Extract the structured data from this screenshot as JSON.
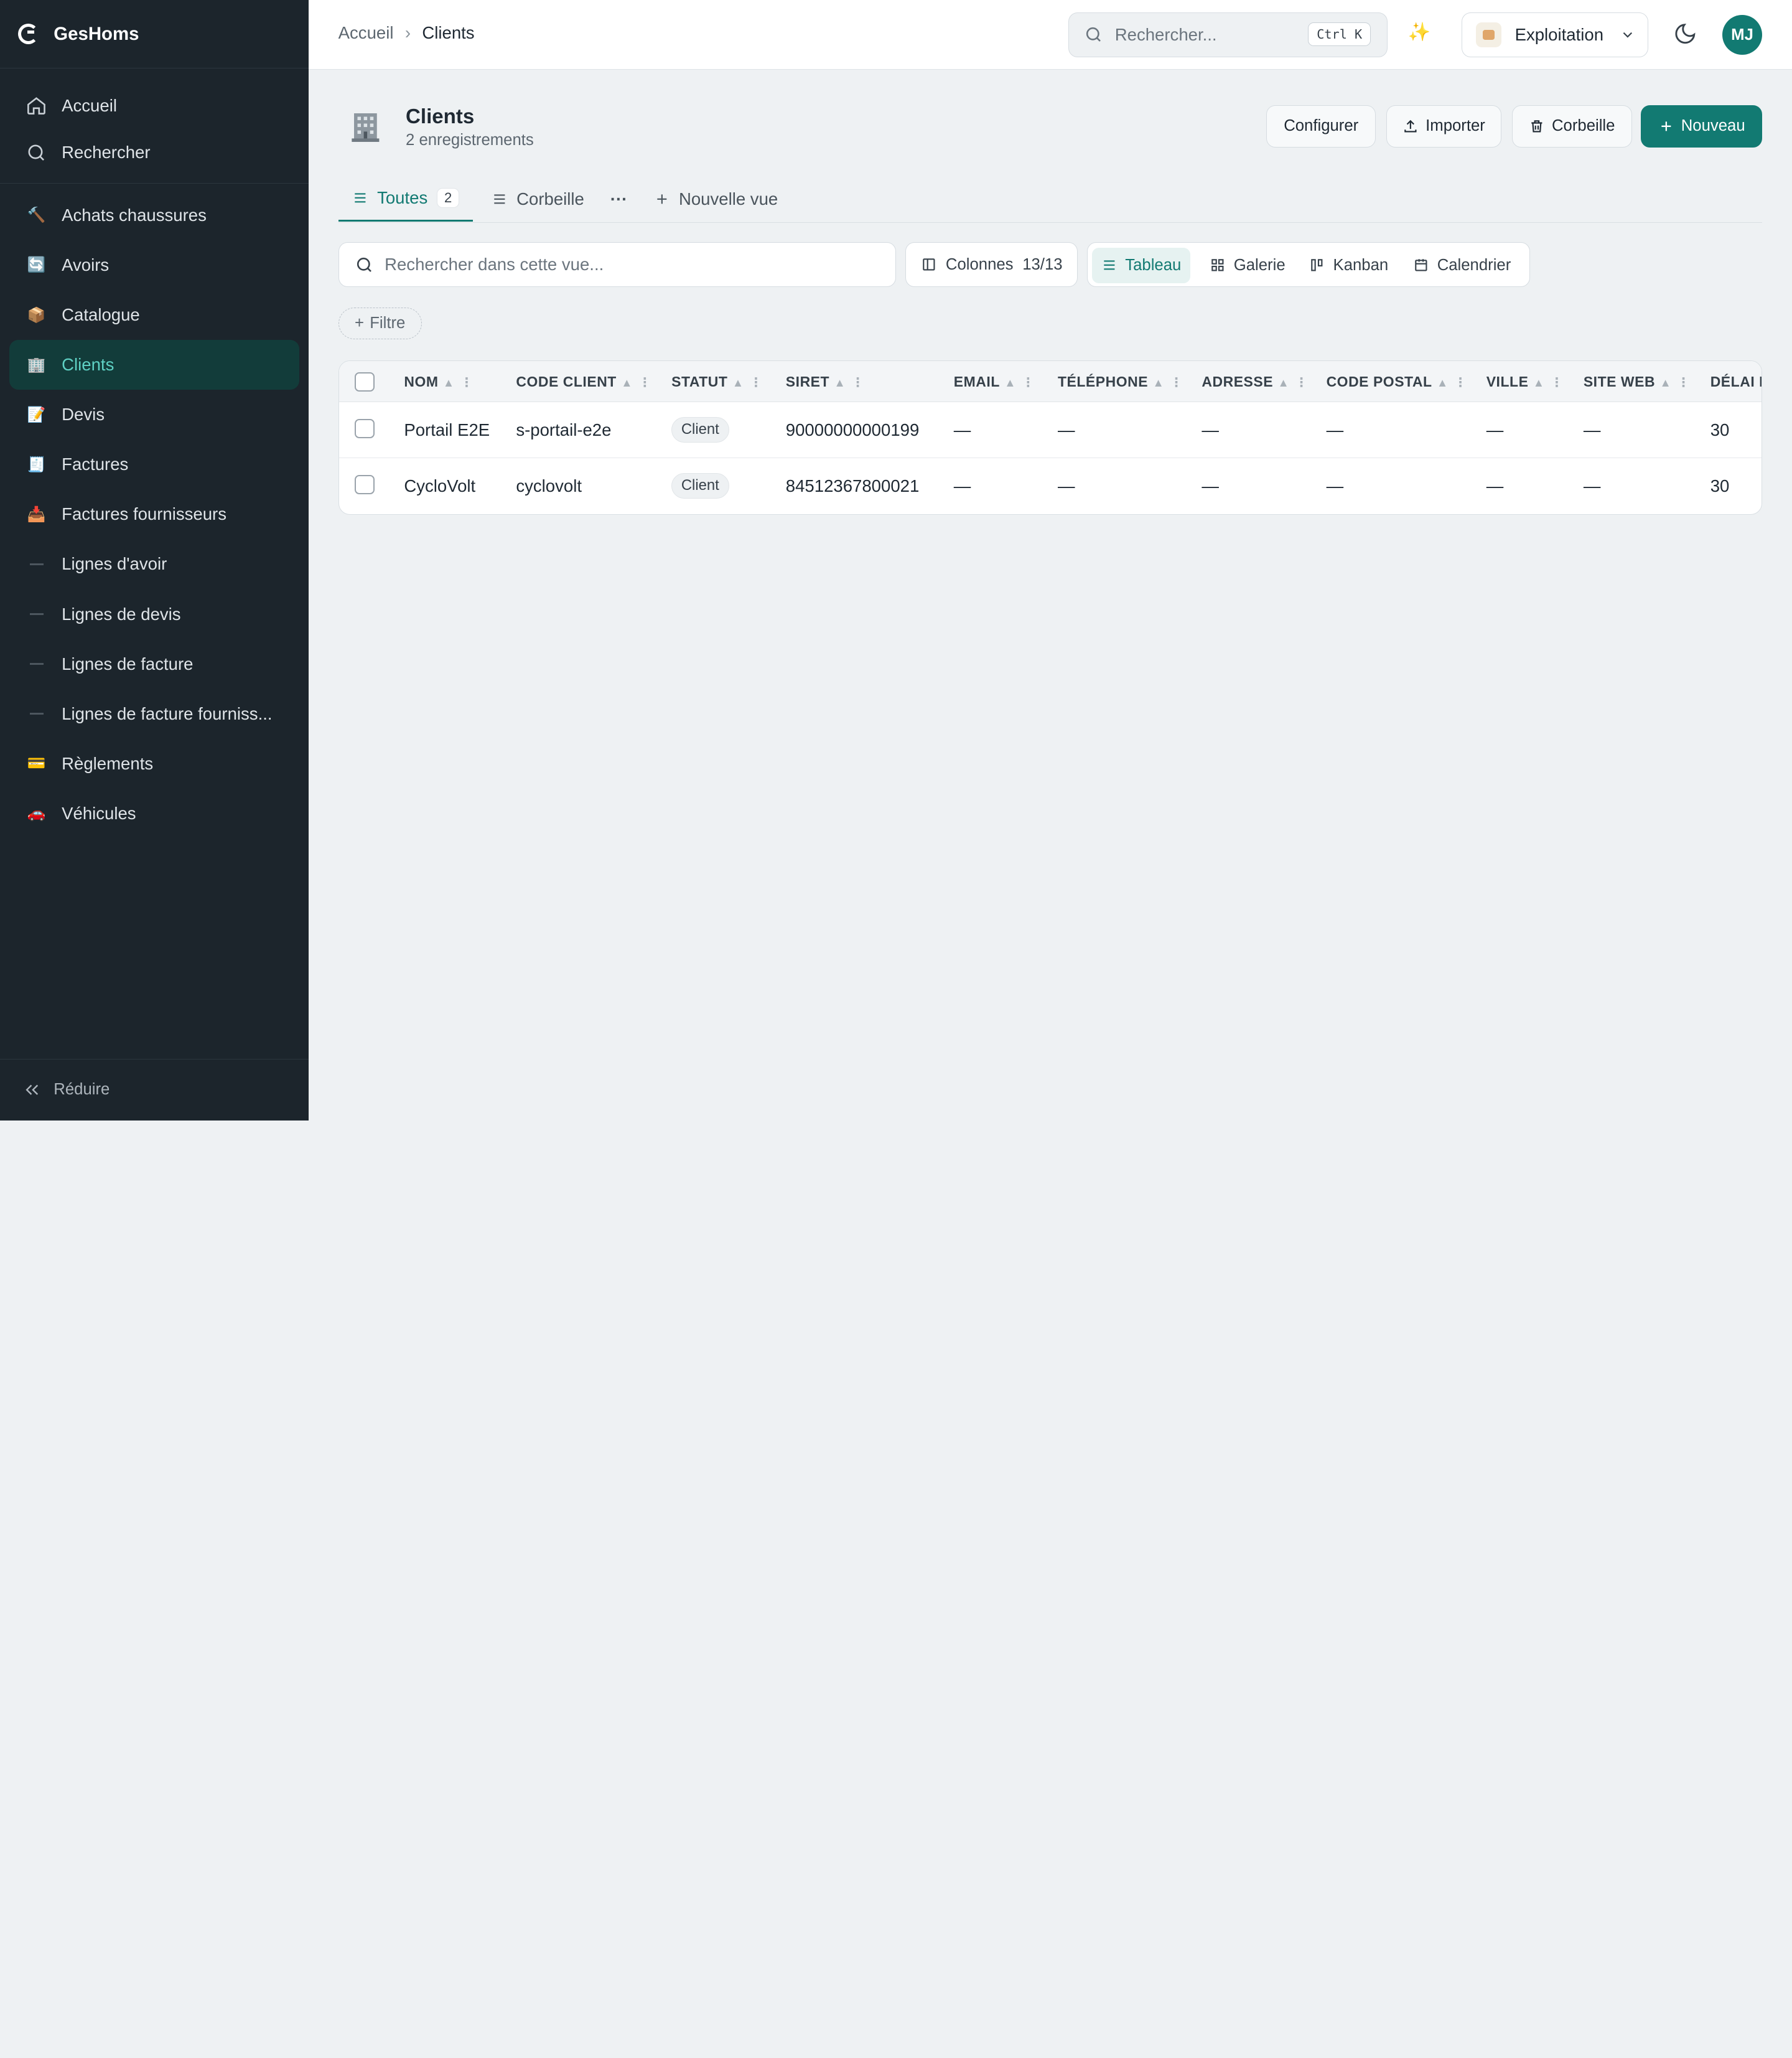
{
  "app": {
    "name": "GesHoms"
  },
  "sidebar": {
    "top_items": [
      {
        "label": "Accueil",
        "icon": "home-icon"
      },
      {
        "label": "Rechercher",
        "icon": "search-icon"
      }
    ],
    "items": [
      {
        "label": "Achats chaussures",
        "icon": "🔨"
      },
      {
        "label": "Avoirs",
        "icon": "🔄"
      },
      {
        "label": "Catalogue",
        "icon": "📦"
      },
      {
        "label": "Clients",
        "icon": "🏢"
      },
      {
        "label": "Devis",
        "icon": "📝"
      },
      {
        "label": "Factures",
        "icon": "🧾"
      },
      {
        "label": "Factures fournisseurs",
        "icon": "📥"
      },
      {
        "label": "Lignes d'avoir",
        "icon": "dash"
      },
      {
        "label": "Lignes de devis",
        "icon": "dash"
      },
      {
        "label": "Lignes de facture",
        "icon": "dash"
      },
      {
        "label": "Lignes de facture fourniss...",
        "icon": "dash"
      },
      {
        "label": "Règlements",
        "icon": "💳"
      },
      {
        "label": "Véhicules",
        "icon": "🚗"
      }
    ],
    "active_item": "Clients",
    "collapse_label": "Réduire"
  },
  "topbar": {
    "breadcrumb": {
      "home": "Accueil",
      "separator": "›",
      "current": "Clients"
    },
    "search_placeholder": "Rechercher...",
    "search_shortcut": "Ctrl K",
    "ai_icon": "✨",
    "workspace": "Exploitation",
    "avatar_initials": "MJ"
  },
  "page": {
    "icon": "🏢",
    "title": "Clients",
    "subtitle": "2 enregistrements",
    "buttons": {
      "configure": "Configurer",
      "import": "Importer",
      "trash": "Corbeille",
      "new": "Nouveau"
    }
  },
  "tabs": {
    "all": {
      "label": "Toutes",
      "count": "2"
    },
    "trash": {
      "label": "Corbeille"
    },
    "more": "···",
    "new_view": "Nouvelle vue"
  },
  "toolbar": {
    "search_placeholder": "Rechercher dans cette vue...",
    "columns_label": "Colonnes",
    "columns_count": "13/13",
    "view_modes": [
      "Tableau",
      "Galerie",
      "Kanban",
      "Calendrier"
    ],
    "active_view": "Tableau",
    "filter_label": "Filtre"
  },
  "table": {
    "columns": [
      "NOM",
      "CODE CLIENT",
      "STATUT",
      "SIRET",
      "EMAIL",
      "TÉLÉPHONE",
      "ADRESSE",
      "CODE POSTAL",
      "VILLE",
      "SITE WEB",
      "DÉLAI D"
    ],
    "rows": [
      {
        "nom": "Portail E2E",
        "code": "s-portail-e2e",
        "statut": "Client",
        "siret": "90000000000199",
        "email": "—",
        "telephone": "—",
        "adresse": "—",
        "code_postal": "—",
        "ville": "—",
        "site_web": "—",
        "delai": "30"
      },
      {
        "nom": "CycloVolt",
        "code": "cyclovolt",
        "statut": "Client",
        "siret": "84512367800021",
        "email": "—",
        "telephone": "—",
        "adresse": "—",
        "code_postal": "—",
        "ville": "—",
        "site_web": "—",
        "delai": "30"
      }
    ]
  },
  "colors": {
    "accent": "#127a72",
    "sidebar_bg": "#1c252c",
    "active_bg": "#123c3a",
    "page_bg": "#eef1f3"
  }
}
